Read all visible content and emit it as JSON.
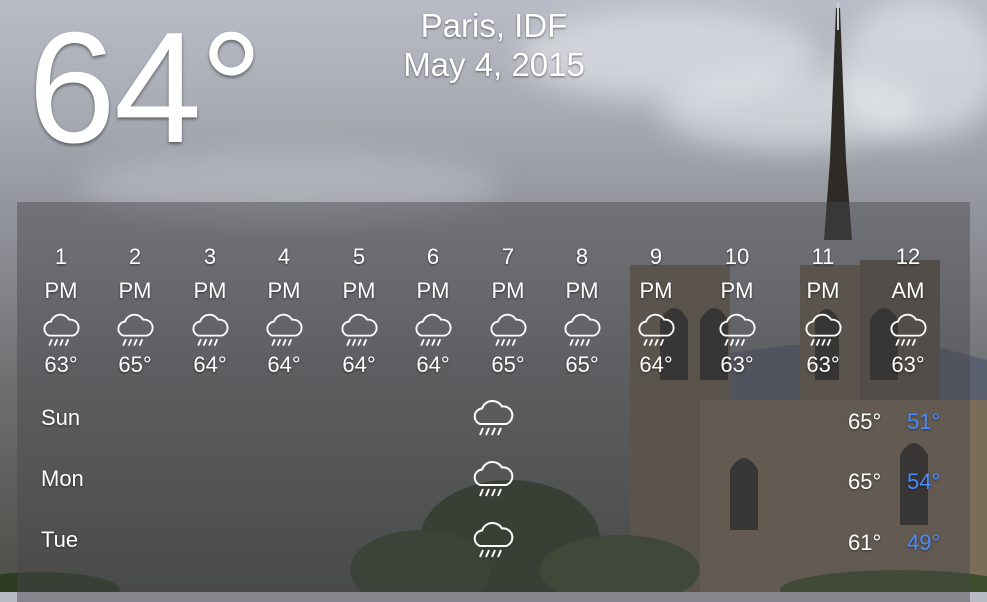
{
  "current": {
    "temperature": "64°"
  },
  "location": {
    "city": "Paris, IDF",
    "date": "May 4, 2015"
  },
  "colors": {
    "low_temp": "#4a8cff",
    "text": "#ffffff"
  },
  "hourly": [
    {
      "hour": "1",
      "ampm": "PM",
      "icon": "rain-cloud-icon",
      "temp": "63°"
    },
    {
      "hour": "2",
      "ampm": "PM",
      "icon": "rain-cloud-icon",
      "temp": "65°"
    },
    {
      "hour": "3",
      "ampm": "PM",
      "icon": "rain-cloud-icon",
      "temp": "64°"
    },
    {
      "hour": "4",
      "ampm": "PM",
      "icon": "rain-cloud-icon",
      "temp": "64°"
    },
    {
      "hour": "5",
      "ampm": "PM",
      "icon": "rain-cloud-icon",
      "temp": "64°"
    },
    {
      "hour": "6",
      "ampm": "PM",
      "icon": "rain-cloud-icon",
      "temp": "64°"
    },
    {
      "hour": "7",
      "ampm": "PM",
      "icon": "rain-cloud-icon",
      "temp": "65°"
    },
    {
      "hour": "8",
      "ampm": "PM",
      "icon": "rain-cloud-icon",
      "temp": "65°"
    },
    {
      "hour": "9",
      "ampm": "PM",
      "icon": "rain-cloud-icon",
      "temp": "64°"
    },
    {
      "hour": "10",
      "ampm": "PM",
      "icon": "rain-cloud-icon",
      "temp": "63°"
    },
    {
      "hour": "11",
      "ampm": "PM",
      "icon": "rain-cloud-icon",
      "temp": "63°"
    },
    {
      "hour": "12",
      "ampm": "AM",
      "icon": "rain-cloud-icon",
      "temp": "63°"
    }
  ],
  "daily": [
    {
      "day": "Sun",
      "icon": "rain-cloud-icon",
      "high": "65°",
      "low": "51°"
    },
    {
      "day": "Mon",
      "icon": "rain-cloud-icon",
      "high": "65°",
      "low": "54°"
    },
    {
      "day": "Tue",
      "icon": "rain-cloud-icon",
      "high": "61°",
      "low": "49°"
    }
  ]
}
